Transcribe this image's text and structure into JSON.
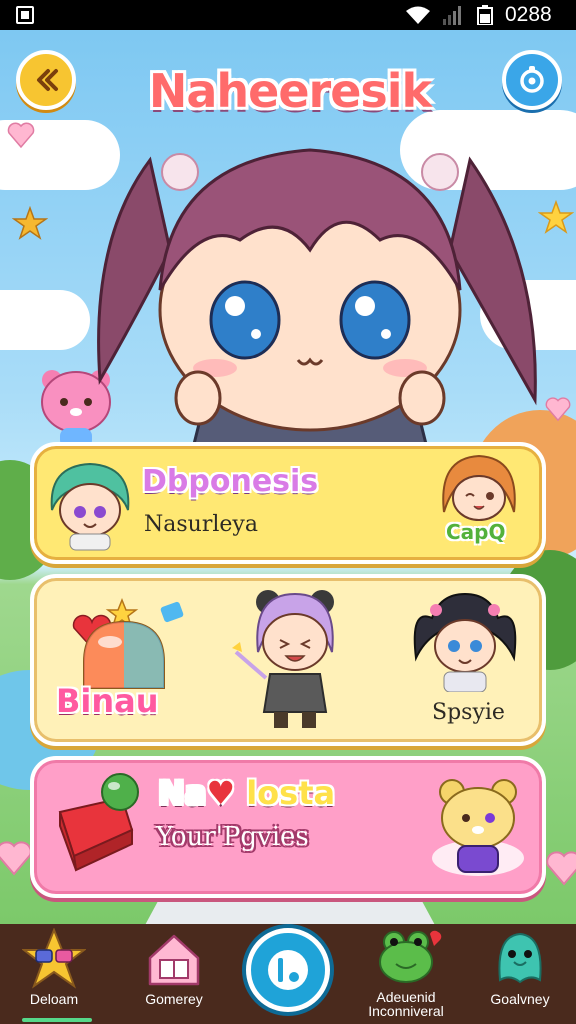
{
  "status_bar": {
    "time": "0288"
  },
  "header": {
    "title": "Naheeresik",
    "back_icon": "chevron-left-icon",
    "settings_icon": "target-icon"
  },
  "cards": [
    {
      "title": "Dbponesis",
      "subtitle": "Nasurleya",
      "badge": "CapQ"
    },
    {
      "title": "Binau",
      "label": "Spsyie"
    },
    {
      "title_parts": [
        "Na",
        "♥",
        " losta"
      ],
      "subtitle": "Your'Pgvies"
    }
  ],
  "bottom_nav": {
    "items": [
      {
        "label": "Deloam",
        "icon": "star-sunglasses-icon",
        "active": true
      },
      {
        "label": "Gomerey",
        "icon": "house-icon",
        "active": false
      },
      {
        "label": "Adeuenid Inconniveral",
        "icon": "frog-icon",
        "active": false
      },
      {
        "label": "Goalvney",
        "icon": "blob-icon",
        "active": false
      }
    ],
    "center_icon": "power-icon"
  },
  "colors": {
    "accent_yellow": "#f7c531",
    "accent_blue": "#3aa6e8",
    "nav_bg": "#4a2a1d",
    "card_pink": "#ff9fc8"
  }
}
